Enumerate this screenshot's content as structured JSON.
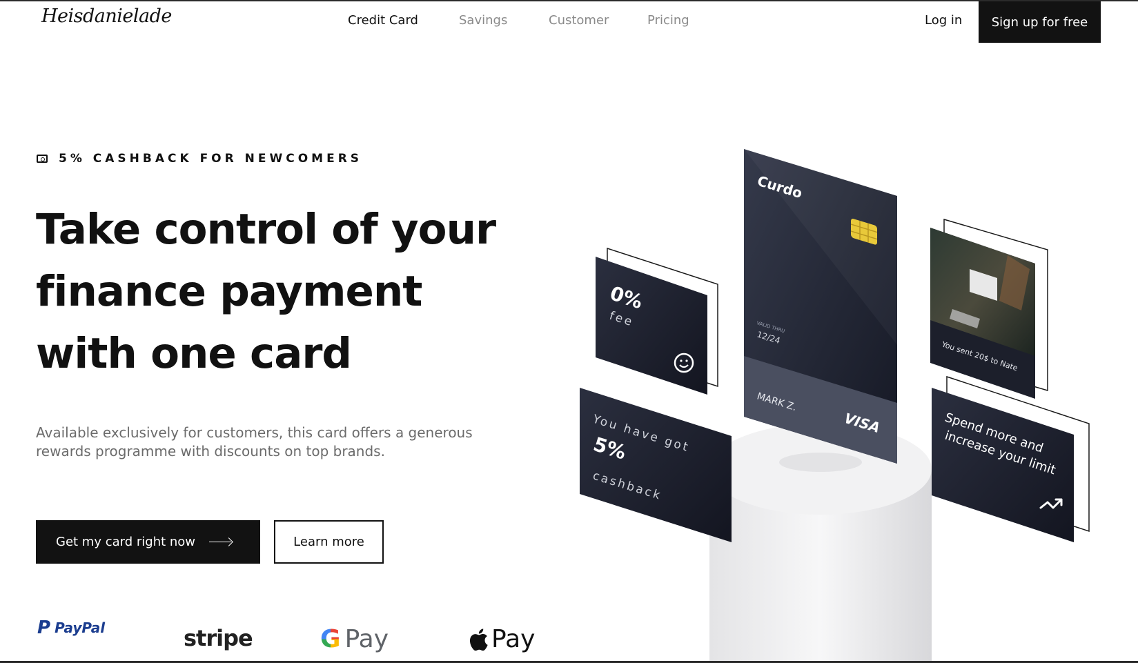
{
  "header": {
    "logo": "Heisdanielade",
    "nav": [
      {
        "label": "Credit Card",
        "active": true
      },
      {
        "label": "Savings",
        "active": false
      },
      {
        "label": "Customer",
        "active": false
      },
      {
        "label": "Pricing",
        "active": false
      }
    ],
    "login_label": "Log in",
    "signup_label": "Sign up for free"
  },
  "hero": {
    "eyebrow_icon": "cash-icon",
    "eyebrow": "5% CASHBACK FOR NEWCOMERS",
    "headline": [
      "Take control of your",
      "finance payment",
      "with one card"
    ],
    "subtitle_lines": [
      "Available exclusively for customers, this card offers a generous",
      "rewards programme with discounts on top brands."
    ],
    "primary_button": "Get my card right now",
    "secondary_button": "Learn more"
  },
  "payments": {
    "paypal": "PayPal",
    "stripe": "stripe",
    "gpay": "Pay",
    "applepay": "Pay"
  },
  "illustration": {
    "main_card": {
      "brand": "Curdo",
      "valid_label": "VALID THRU",
      "valid_date": "12/24",
      "holder": "MARK Z.",
      "network": "VISA"
    },
    "fee_card": {
      "value": "0%",
      "label": "fee"
    },
    "cashback_card": {
      "line1": "You have got",
      "value": "5%",
      "label": "cashback"
    },
    "photo_card": {
      "caption": "You sent 20$ to Nate"
    },
    "limit_card": {
      "line1": "Spend more and",
      "line2": "increase your limit"
    },
    "colors": {
      "card_dark": "#1c1f2b",
      "card_mid": "#2a2e3d",
      "chip": "#e8c93a"
    }
  }
}
